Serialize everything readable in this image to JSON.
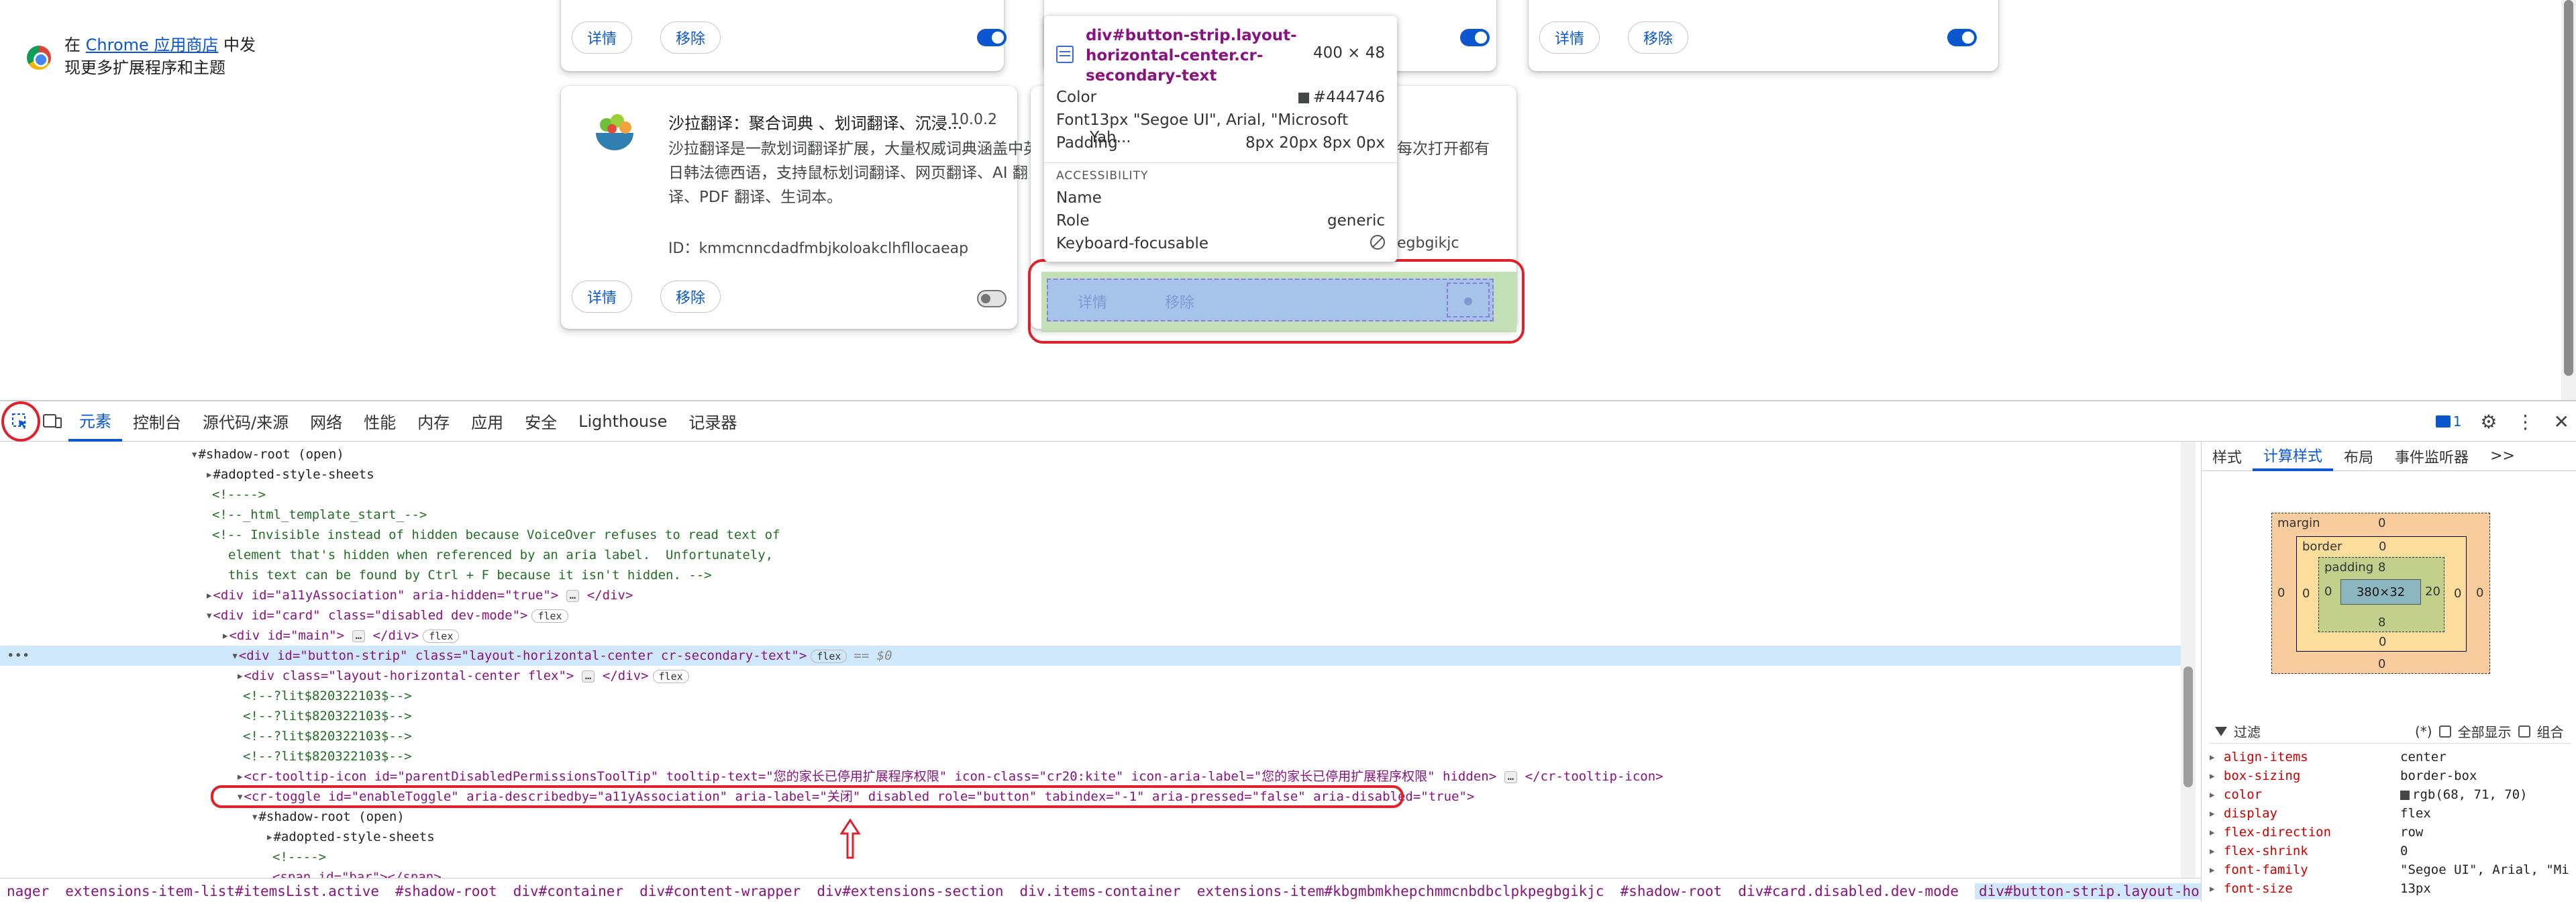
{
  "store": {
    "prefix": "在",
    "link": "Chrome 应用商店",
    "suffix_line1": "中发",
    "line2": "现更多扩展程序和主题"
  },
  "buttons": {
    "details": "详情",
    "remove": "移除"
  },
  "extension": {
    "name": "沙拉翻译：聚合词典 、划词翻译、沉浸...",
    "version": "10.0.2",
    "description": "沙拉翻译是一款划词翻译扩展，大量权威词典涵盖中英日韩法德西语，支持鼠标划词翻译、网页翻译、AI 翻译、PDF 翻译、生词本。",
    "id_label": "ID：",
    "id_value": "kmmcnncdadfmbjkoloakclhfllocaeap"
  },
  "partial_texts": {
    "card3_desc_tail": "每次打开都有",
    "card3_id_tail": "egbgikjc"
  },
  "tooltip": {
    "selector": "div#button-strip.layout-horizontal-center.cr-secondary-text",
    "size": "400 × 48",
    "color_label": "Color",
    "color_value": "#444746",
    "font_label": "Font",
    "font_value": "13px \"Segoe UI\", Arial, \"Microsoft Yah...",
    "padding_label": "Padding",
    "padding_value": "8px 20px 8px 0px",
    "accessibility_header": "ACCESSIBILITY",
    "name_label": "Name",
    "name_value": "",
    "role_label": "Role",
    "role_value": "generic",
    "focus_label": "Keyboard-focusable"
  },
  "devtools": {
    "tabs": [
      "元素",
      "控制台",
      "源代码/来源",
      "网络",
      "性能",
      "内存",
      "应用",
      "安全",
      "Lighthouse",
      "记录器"
    ],
    "active_tab": "元素",
    "issues_count": "1",
    "side_tabs": [
      "样式",
      "计算样式",
      "布局",
      "事件监听器",
      ">>"
    ],
    "active_side_tab": "计算样式",
    "box_model": {
      "margin_label": "margin",
      "border_label": "border",
      "padding_label": "padding",
      "margin": "0",
      "border": "0",
      "padding_top": "8",
      "padding_right": "20",
      "padding_bottom": "8",
      "padding_left": "0",
      "content": "380×32",
      "zero": "0"
    },
    "filter": {
      "label": "过滤",
      "hint": "(*)",
      "show_all": "全部显示",
      "group": "组合"
    },
    "computed": [
      {
        "name": "align-items",
        "value": "center"
      },
      {
        "name": "box-sizing",
        "value": "border-box"
      },
      {
        "name": "color",
        "value": "rgb(68, 71, 70)"
      },
      {
        "name": "display",
        "value": "flex"
      },
      {
        "name": "flex-direction",
        "value": "row"
      },
      {
        "name": "flex-shrink",
        "value": "0"
      },
      {
        "name": "font-family",
        "value": "\"Segoe UI\", Arial, \"Mi"
      },
      {
        "name": "font-size",
        "value": "13px"
      }
    ],
    "breadcrumbs": [
      "nager",
      "extensions-item-list#itemsList.active",
      "#shadow-root",
      "div#container",
      "div#content-wrapper",
      "div#extensions-section",
      "div.items-container",
      "extensions-item#kbgmbmkhepchmmcnbdbclpkpegbgikjc",
      "#shadow-root",
      "div#card.disabled.dev-mode",
      "div#button-strip.layout-horizontal-center.cr-secondary-text"
    ],
    "dom": {
      "shadow_root": "#shadow-root (open)",
      "adopted": "#adopted-style-sheets",
      "c_empty": "<!---->",
      "c_template": "<!--_html_template_start_-->",
      "c_invisible1": "<!-- Invisible instead of hidden because VoiceOver refuses to read text of",
      "c_invisible2": "element that's hidden when referenced by an aria label.  Unfortunately,",
      "c_invisible3": "this text can be found by Ctrl + F because it isn't hidden. -->",
      "a11y_open": "<div id=\"a11yAssociation\" aria-hidden=\"true\">",
      "div_close": "</div>",
      "card_open": "<div id=\"card\" class=\"disabled dev-mode\">",
      "main_open": "<div id=\"main\">",
      "strip_open": "<div id=\"button-strip\" class=\"layout-horizontal-center cr-secondary-text\">",
      "dollar0": "== $0",
      "lhc_open": "<div class=\"layout-horizontal-center flex\">",
      "lit": "<!--?lit$820322103$-->",
      "tooltip_icon": "<cr-tooltip-icon id=\"parentDisabledPermissionsToolTip\" tooltip-text=\"您的家长已停用扩展程序权限\" icon-class=\"cr20:kite\" icon-aria-label=\"您的家长已停用扩展程序权限\" hidden>",
      "tooltip_icon_close": "</cr-tooltip-icon>",
      "toggle": "<cr-toggle id=\"enableToggle\" aria-describedby=\"a11yAssociation\" aria-label=\"关闭\" disabled role=\"button\" tabindex=\"-1\" aria-pressed=\"false\" aria-disabled=\"true\">",
      "span_bar": "<span id=\"bar\"></span>",
      "flex": "flex",
      "ellipsis": "…"
    }
  }
}
